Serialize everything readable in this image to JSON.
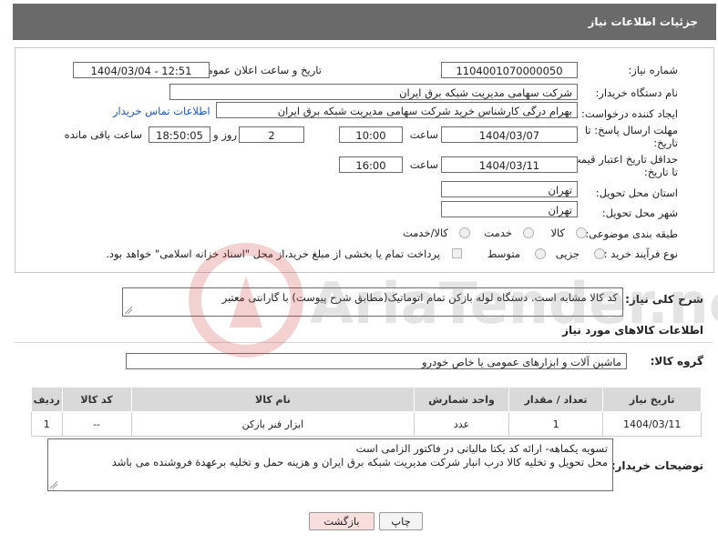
{
  "header": {
    "title": "جزئیات اطلاعات نیاز"
  },
  "form": {
    "need_number_label": "شماره نیاز:",
    "need_number": "1104001070000050",
    "announce_label": "تاریخ و ساعت اعلان عمومی:",
    "announce_value": "1404/03/04 - 12:51",
    "buyer_label": "نام دستگاه خریدار:",
    "buyer_value": "شرکت سهامی مدیریت شبکه برق ایران",
    "creator_label": "ایجاد کننده درخواست:",
    "creator_value": "بهرام درگی کارشناس خرید شرکت سهامی مدیریت شبکه برق ایران",
    "contact_link": "اطلاعات تماس خریدار",
    "deadline_label_1": "مهلت ارسال پاسخ: تا",
    "deadline_label_2": "تاریخ:",
    "deadline_date": "1404/03/07",
    "time_label": "ساعت",
    "deadline_time": "10:00",
    "days_value": "2",
    "days_label": "روز و",
    "remaining_value": "18:50:05",
    "remaining_label": "ساعت باقی مانده",
    "min_price_label_1": "حداقل تاریخ اعتبار قیمت:",
    "min_price_label_2": "تا تاریخ:",
    "price_date": "1404/03/11",
    "price_time": "16:00",
    "province_label": "استان محل تحویل:",
    "province_value": "تهران",
    "city_label": "شهر محل تحویل:",
    "city_value": "تهران",
    "category_label": "طبقه بندی موضوعی:",
    "category_options": [
      "کالا",
      "خدمت",
      "کالا/خدمت"
    ],
    "purchase_label": "نوع فرآیند خرید :",
    "purchase_options": [
      "جزیی",
      "متوسط"
    ],
    "payment_note": "پرداخت تمام یا بخشی از مبلغ خرید،از محل \"اسناد خزانه اسلامی\" خواهد بود."
  },
  "description": {
    "label": "شرح کلی نیاز:",
    "value": "کد کالا مشابه است. دستگاه لوله بازکن تمام اتوماتیک(مطابق شرح پیوست) با گارانتی معتبر"
  },
  "goods_info": {
    "title": "اطلاعات کالاهای مورد نیاز",
    "group_label": "گروه کالا:",
    "group_value": "ماشین آلات و ابزارهای عمومی یا خاص خودرو"
  },
  "table": {
    "headers": [
      "ردیف",
      "کد کالا",
      "نام کالا",
      "واحد شمارش",
      "تعداد / مقدار",
      "تاریخ نیاز"
    ],
    "rows": [
      [
        "1",
        "--",
        "ابزار فنر بازکن",
        "عدد",
        "1",
        "1404/03/11"
      ]
    ]
  },
  "buyer_notes": {
    "label": "توضیحات خریدار:",
    "line1": "تسویه یکماهه- ارائه کد یکتا مالیاتی در فاکتور الزامی است",
    "line2": "محل تحویل و تخلیه کالا درب انبار شرکت مدیریت شبکه برق ایران  و هزینه حمل و تخلیه برعهدة فروشنده می باشد"
  },
  "buttons": {
    "print": "چاپ",
    "back": "بازگشت"
  },
  "watermark": {
    "text": "AriaTender.neT"
  },
  "colors": {
    "header_bg": "#6a6a6a",
    "link": "#1a55c8",
    "table_header": "#d9d9d9",
    "back_button": "#f9dede"
  }
}
